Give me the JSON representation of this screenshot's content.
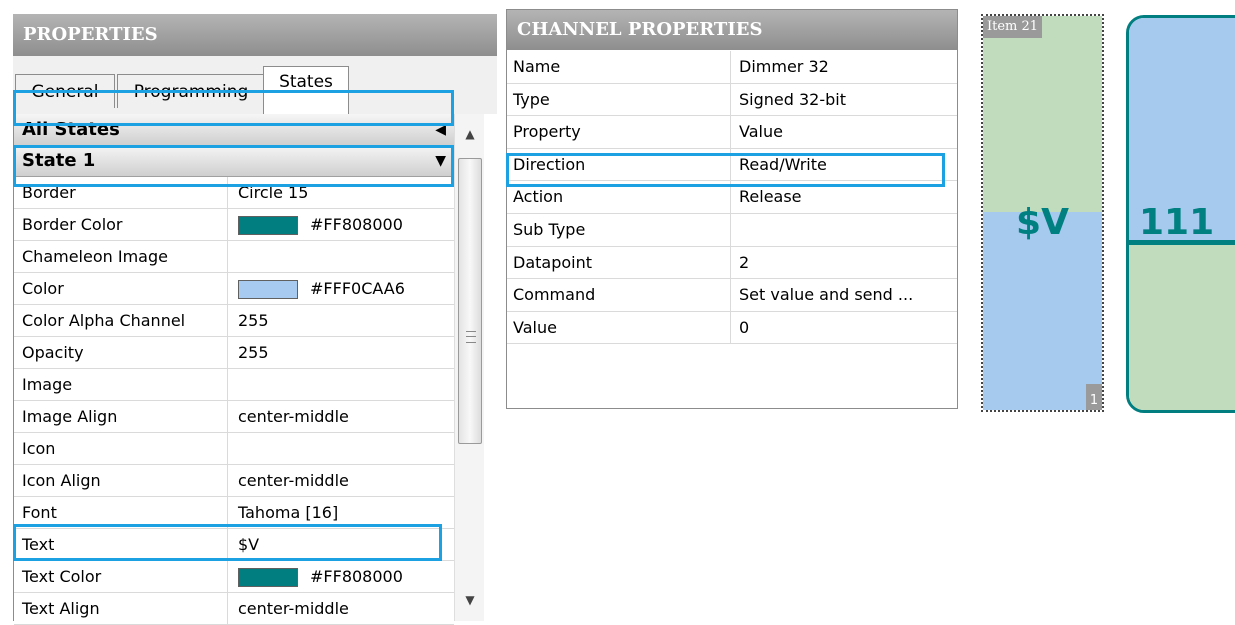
{
  "properties_panel": {
    "title": "PROPERTIES",
    "tabs": [
      "General",
      "Programming",
      "States"
    ],
    "active_tab": "States",
    "group_all_states": "All States",
    "group_state1": "State 1",
    "rows": [
      {
        "name": "Border",
        "value": "Circle 15"
      },
      {
        "name": "Border Color",
        "value": "#FF808000",
        "swatch": "#007e80"
      },
      {
        "name": "Chameleon Image",
        "value": ""
      },
      {
        "name": "Color",
        "value": "#FFF0CAA6",
        "swatch": "#a6caf0"
      },
      {
        "name": "Color Alpha Channel",
        "value": "255"
      },
      {
        "name": "Opacity",
        "value": "255"
      },
      {
        "name": "Image",
        "value": ""
      },
      {
        "name": "Image Align",
        "value": "center-middle"
      },
      {
        "name": "Icon",
        "value": ""
      },
      {
        "name": "Icon Align",
        "value": "center-middle"
      },
      {
        "name": "Font",
        "value": "Tahoma [16]"
      },
      {
        "name": "Text",
        "value": "$V"
      },
      {
        "name": "Text Color",
        "value": "#FF808000",
        "swatch": "#007e80"
      },
      {
        "name": "Text Align",
        "value": "center-middle"
      }
    ]
  },
  "channel_panel": {
    "title": "CHANNEL PROPERTIES",
    "rows": [
      {
        "name": "Name",
        "value": "Dimmer 32"
      },
      {
        "name": "Type",
        "value": "Signed 32-bit"
      },
      {
        "name": "Property",
        "value": "Value"
      },
      {
        "name": "Direction",
        "value": "Read/Write"
      },
      {
        "name": "Action",
        "value": "Release"
      },
      {
        "name": "Sub Type",
        "value": ""
      },
      {
        "name": "Datapoint",
        "value": "2"
      },
      {
        "name": "Command",
        "value": "Set value and send ..."
      },
      {
        "name": "Value",
        "value": "0"
      }
    ]
  },
  "canvas": {
    "item21": {
      "label": "Item 21",
      "text": "$V",
      "index": "1"
    },
    "item_b": {
      "text": "111"
    }
  },
  "colors": {
    "highlight": "#1ca1e2",
    "teal": "#007e80",
    "light_blue": "#a6caf0",
    "light_green": "#c1dcbc"
  }
}
